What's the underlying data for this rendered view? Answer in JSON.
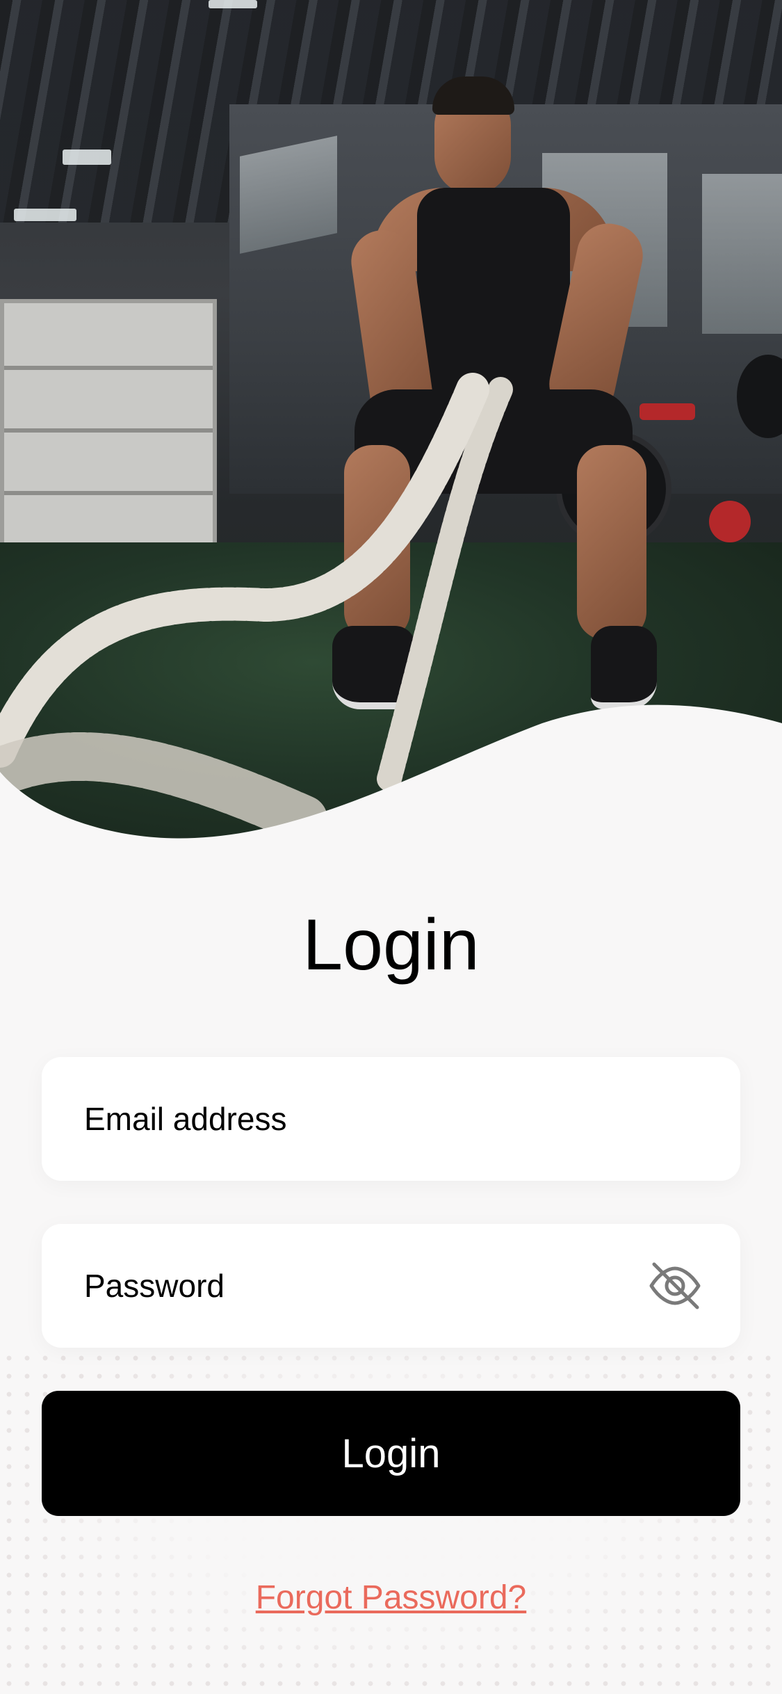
{
  "hero": {
    "image": "gym-athlete-battle-ropes-photo"
  },
  "title": "Login",
  "email": {
    "placeholder": "Email address",
    "value": ""
  },
  "password": {
    "placeholder": "Password",
    "value": "",
    "toggle_icon": "eye-slash-icon"
  },
  "login_button": "Login",
  "forgot_password": "Forgot Password?",
  "colors": {
    "background": "#f8f7f7",
    "button": "#000000",
    "link": "#ea6a5c",
    "field": "#ffffff"
  }
}
